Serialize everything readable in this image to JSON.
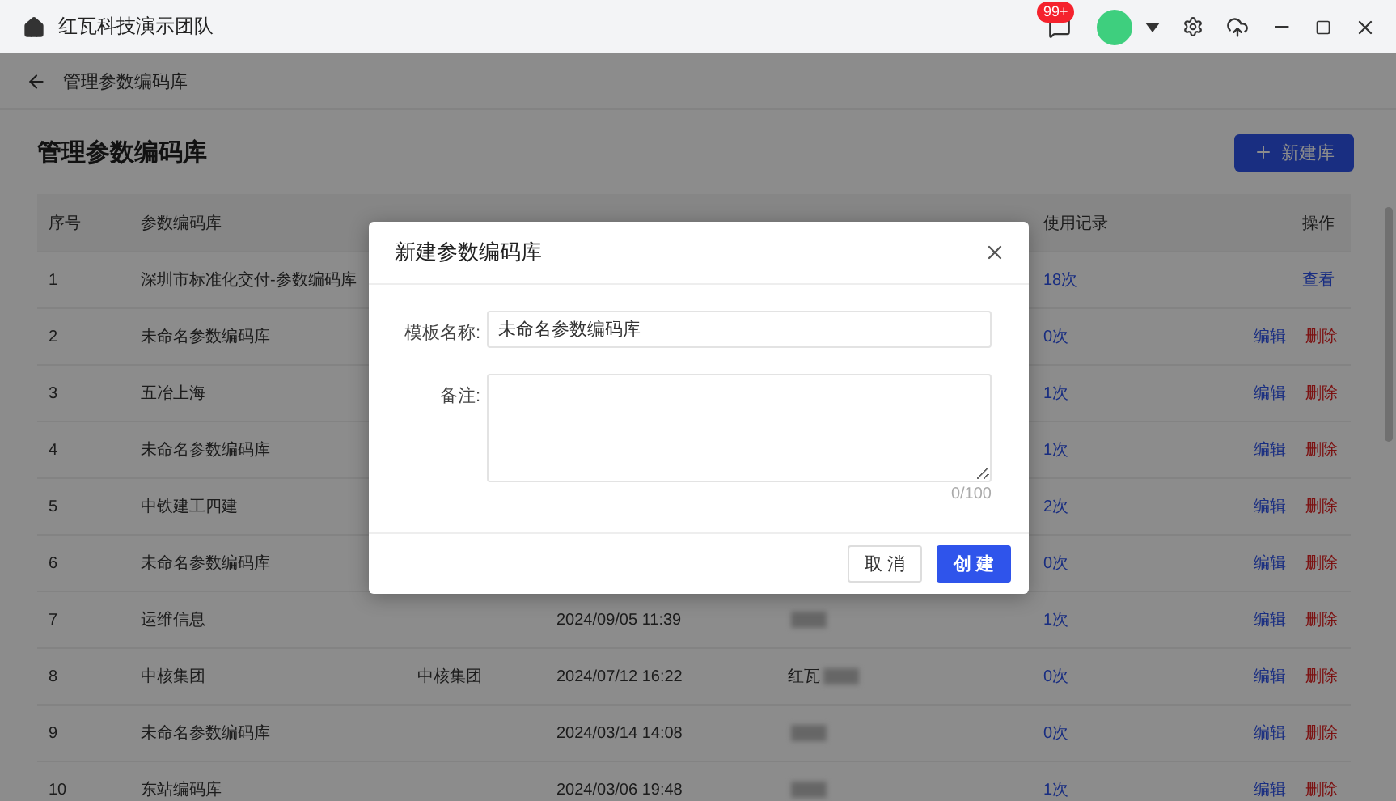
{
  "title_bar": {
    "title": "红瓦科技演示团队",
    "badge": "99+"
  },
  "breadcrumb": {
    "label": "管理参数编码库"
  },
  "page": {
    "title": "管理参数编码库",
    "new_button": "新建库"
  },
  "table": {
    "headers": {
      "index": "序号",
      "name": "参数编码库",
      "usage": "使用记录",
      "actions": "操作"
    },
    "rows": [
      {
        "index": "1",
        "name": "深圳市标准化交付-参数编码库",
        "usage": "18次",
        "actions": [
          {
            "label": "查看",
            "kind": "view"
          }
        ]
      },
      {
        "index": "2",
        "name": "未命名参数编码库",
        "usage": "0次",
        "actions": [
          {
            "label": "编辑",
            "kind": "edit"
          },
          {
            "label": "删除",
            "kind": "delete"
          }
        ]
      },
      {
        "index": "3",
        "name": "五冶上海",
        "usage": "1次",
        "actions": [
          {
            "label": "编辑",
            "kind": "edit"
          },
          {
            "label": "删除",
            "kind": "delete"
          }
        ]
      },
      {
        "index": "4",
        "name": "未命名参数编码库",
        "usage": "1次",
        "actions": [
          {
            "label": "编辑",
            "kind": "edit"
          },
          {
            "label": "删除",
            "kind": "delete"
          }
        ]
      },
      {
        "index": "5",
        "name": "中铁建工四建",
        "usage": "2次",
        "actions": [
          {
            "label": "编辑",
            "kind": "edit"
          },
          {
            "label": "删除",
            "kind": "delete"
          }
        ]
      },
      {
        "index": "6",
        "name": "未命名参数编码库",
        "usage": "0次",
        "actions": [
          {
            "label": "编辑",
            "kind": "edit"
          },
          {
            "label": "删除",
            "kind": "delete"
          }
        ]
      },
      {
        "index": "7",
        "name": "运维信息",
        "updated": "2024/09/05 11:39",
        "redacted": true,
        "usage": "1次",
        "actions": [
          {
            "label": "编辑",
            "kind": "edit"
          },
          {
            "label": "删除",
            "kind": "delete"
          }
        ]
      },
      {
        "index": "8",
        "name": "中核集团",
        "note": "中核集团",
        "updated": "2024/07/12 16:22",
        "updater": "红瓦",
        "redacted": true,
        "usage": "0次",
        "actions": [
          {
            "label": "编辑",
            "kind": "edit"
          },
          {
            "label": "删除",
            "kind": "delete"
          }
        ]
      },
      {
        "index": "9",
        "name": "未命名参数编码库",
        "updated": "2024/03/14 14:08",
        "redacted": true,
        "usage": "0次",
        "actions": [
          {
            "label": "编辑",
            "kind": "edit"
          },
          {
            "label": "删除",
            "kind": "delete"
          }
        ]
      },
      {
        "index": "10",
        "name": "东站编码库",
        "updated": "2024/03/06 19:48",
        "redacted": true,
        "usage": "1次",
        "actions": [
          {
            "label": "编辑",
            "kind": "edit"
          },
          {
            "label": "删除",
            "kind": "delete"
          }
        ]
      }
    ]
  },
  "dialog": {
    "title": "新建参数编码库",
    "fields": [
      {
        "label": "模板名称:",
        "kind": "input",
        "value": "未命名参数编码库"
      },
      {
        "label": "备注:",
        "kind": "textarea",
        "counter": "0/100"
      }
    ],
    "buttons": [
      {
        "label": "取 消",
        "kind": "default"
      },
      {
        "label": "创 建",
        "kind": "primary"
      }
    ]
  }
}
